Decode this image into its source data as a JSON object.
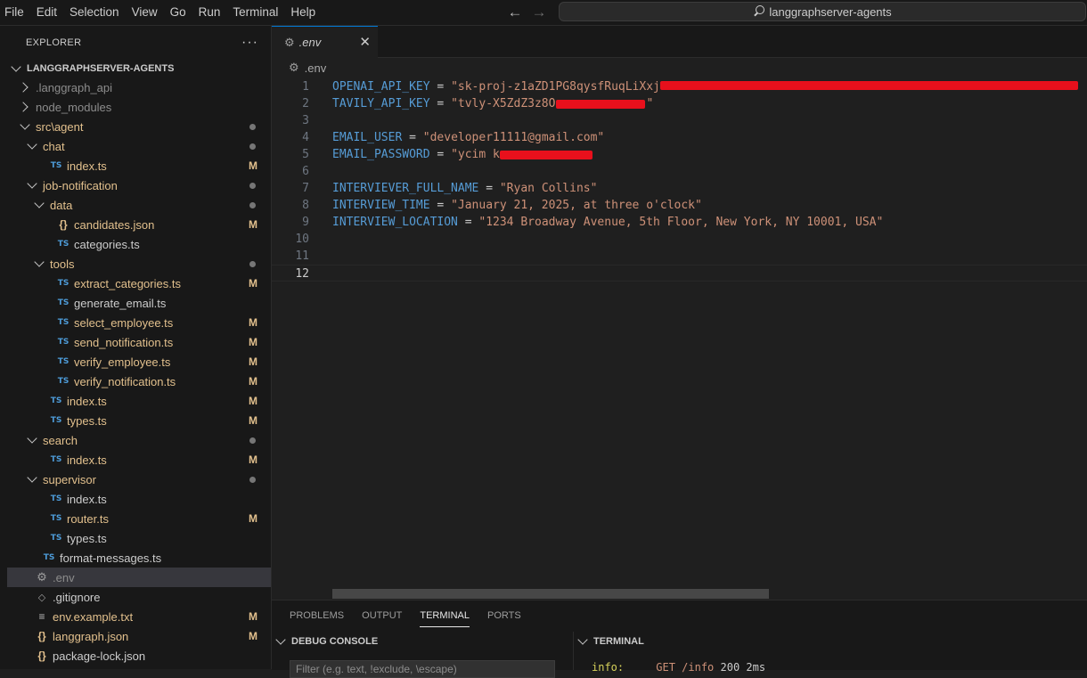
{
  "menu": [
    "File",
    "Edit",
    "Selection",
    "View",
    "Go",
    "Run",
    "Terminal",
    "Help"
  ],
  "search": {
    "text": "langgraphserver-agents",
    "icon": "search-icon"
  },
  "explorer": {
    "title": "EXPLORER",
    "more": "···",
    "root": "LANGGRAPHSERVER-AGENTS",
    "items": [
      {
        "label": ".langgraph_api",
        "depth": 0,
        "type": "folder",
        "open": false,
        "style": "dimmed"
      },
      {
        "label": "node_modules",
        "depth": 0,
        "type": "folder",
        "open": false,
        "style": "dimmed"
      },
      {
        "label": "src\\agent",
        "depth": 0,
        "type": "folder",
        "open": true,
        "style": "modified",
        "dot": true
      },
      {
        "label": "chat",
        "depth": 1,
        "type": "folder",
        "open": true,
        "style": "modified",
        "dot": true
      },
      {
        "label": "index.ts",
        "depth": 2,
        "type": "ts",
        "style": "modified",
        "badge": "M"
      },
      {
        "label": "job-notification",
        "depth": 1,
        "type": "folder",
        "open": true,
        "style": "modified",
        "dot": true
      },
      {
        "label": "data",
        "depth": 2,
        "type": "folder",
        "open": true,
        "style": "modified",
        "dot": true
      },
      {
        "label": "candidates.json",
        "depth": 3,
        "type": "json",
        "style": "modified",
        "badge": "M"
      },
      {
        "label": "categories.ts",
        "depth": 3,
        "type": "ts",
        "style": "normal"
      },
      {
        "label": "tools",
        "depth": 2,
        "type": "folder",
        "open": true,
        "style": "modified",
        "dot": true
      },
      {
        "label": "extract_categories.ts",
        "depth": 3,
        "type": "ts",
        "style": "modified",
        "badge": "M"
      },
      {
        "label": "generate_email.ts",
        "depth": 3,
        "type": "ts",
        "style": "normal"
      },
      {
        "label": "select_employee.ts",
        "depth": 3,
        "type": "ts",
        "style": "modified",
        "badge": "M"
      },
      {
        "label": "send_notification.ts",
        "depth": 3,
        "type": "ts",
        "style": "modified",
        "badge": "M"
      },
      {
        "label": "verify_employee.ts",
        "depth": 3,
        "type": "ts",
        "style": "modified",
        "badge": "M"
      },
      {
        "label": "verify_notification.ts",
        "depth": 3,
        "type": "ts",
        "style": "modified",
        "badge": "M"
      },
      {
        "label": "index.ts",
        "depth": 2,
        "type": "ts",
        "style": "modified",
        "badge": "M"
      },
      {
        "label": "types.ts",
        "depth": 2,
        "type": "ts",
        "style": "modified",
        "badge": "M"
      },
      {
        "label": "search",
        "depth": 1,
        "type": "folder",
        "open": true,
        "style": "modified",
        "dot": true
      },
      {
        "label": "index.ts",
        "depth": 2,
        "type": "ts",
        "style": "modified",
        "badge": "M"
      },
      {
        "label": "supervisor",
        "depth": 1,
        "type": "folder",
        "open": true,
        "style": "modified",
        "dot": true
      },
      {
        "label": "index.ts",
        "depth": 2,
        "type": "ts",
        "style": "normal"
      },
      {
        "label": "router.ts",
        "depth": 2,
        "type": "ts",
        "style": "modified",
        "badge": "M"
      },
      {
        "label": "types.ts",
        "depth": 2,
        "type": "ts",
        "style": "normal"
      },
      {
        "label": "format-messages.ts",
        "depth": 1,
        "type": "ts",
        "style": "normal"
      },
      {
        "label": ".env",
        "depth": 0,
        "type": "gear",
        "style": "dimmed",
        "selected": true
      },
      {
        "label": ".gitignore",
        "depth": 0,
        "type": "git",
        "style": "normal"
      },
      {
        "label": "env.example.txt",
        "depth": 0,
        "type": "txt",
        "style": "modified",
        "badge": "M"
      },
      {
        "label": "langgraph.json",
        "depth": 0,
        "type": "json",
        "style": "modified",
        "badge": "M"
      },
      {
        "label": "package-lock.json",
        "depth": 0,
        "type": "json",
        "style": "normal"
      }
    ]
  },
  "tab": {
    "label": ".env",
    "close": "✕"
  },
  "breadcrumb": ".env",
  "editor": {
    "active_line": 12,
    "lines": [
      {
        "n": "1",
        "key": "OPENAI_API_KEY",
        "val": "\"sk-proj-z1aZD1PG8qysfRuqLiXxj",
        "redacted": true
      },
      {
        "n": "2",
        "key": "TAVILY_API_KEY",
        "val": "\"tvly-X5ZdZ3z8O",
        "tail": "\"",
        "redacted": true
      },
      {
        "n": "3"
      },
      {
        "n": "4",
        "key": "EMAIL_USER",
        "val": "\"developer11111@gmail.com\""
      },
      {
        "n": "5",
        "key": "EMAIL_PASSWORD",
        "val": "\"ycim k",
        "redacted": true
      },
      {
        "n": "6"
      },
      {
        "n": "7",
        "key": "INTERVIEVER_FULL_NAME",
        "val": "\"Ryan Collins\""
      },
      {
        "n": "8",
        "key": "INTERVIEW_TIME",
        "val": "\"January 21, 2025, at three o'clock\""
      },
      {
        "n": "9",
        "key": "INTERVIEW_LOCATION",
        "val": "\"1234 Broadway Avenue, 5th Floor, New York, NY 10001, USA\""
      },
      {
        "n": "10"
      },
      {
        "n": "11"
      },
      {
        "n": "12"
      }
    ]
  },
  "panel": {
    "tabs": [
      "PROBLEMS",
      "OUTPUT",
      "TERMINAL",
      "PORTS"
    ],
    "active_tab": "TERMINAL",
    "debug_title": "DEBUG CONSOLE",
    "filter_placeholder": "Filter (e.g. text, !exclude, \\escape)",
    "terminal_title": "TERMINAL",
    "terminal_info": "info:",
    "terminal_req": "GET /info",
    "terminal_status": "200 2ms"
  },
  "colors": {
    "keyword": "#569cd6",
    "string": "#ce9178",
    "modified": "#e2c08d",
    "redaction": "#e8101c",
    "accent": "#0078d4"
  }
}
